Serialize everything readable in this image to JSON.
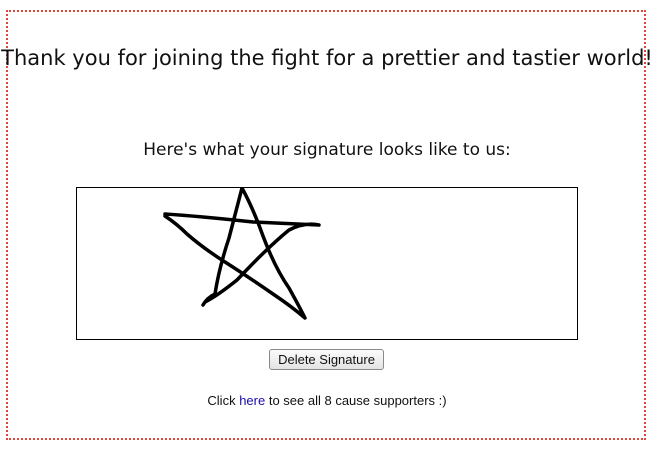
{
  "page": {
    "heading": "Thank you for joining the fight for a prettier and tastier world!",
    "subheading": "Here's what your signature looks like to us:",
    "delete_button_label": "Delete Signature",
    "footer": {
      "prefix": "Click ",
      "link_text": "here",
      "suffix": " to see all 8 cause supporters :)"
    }
  },
  "colors": {
    "frame_border": "#e0453a",
    "link": "#1a0dab"
  }
}
